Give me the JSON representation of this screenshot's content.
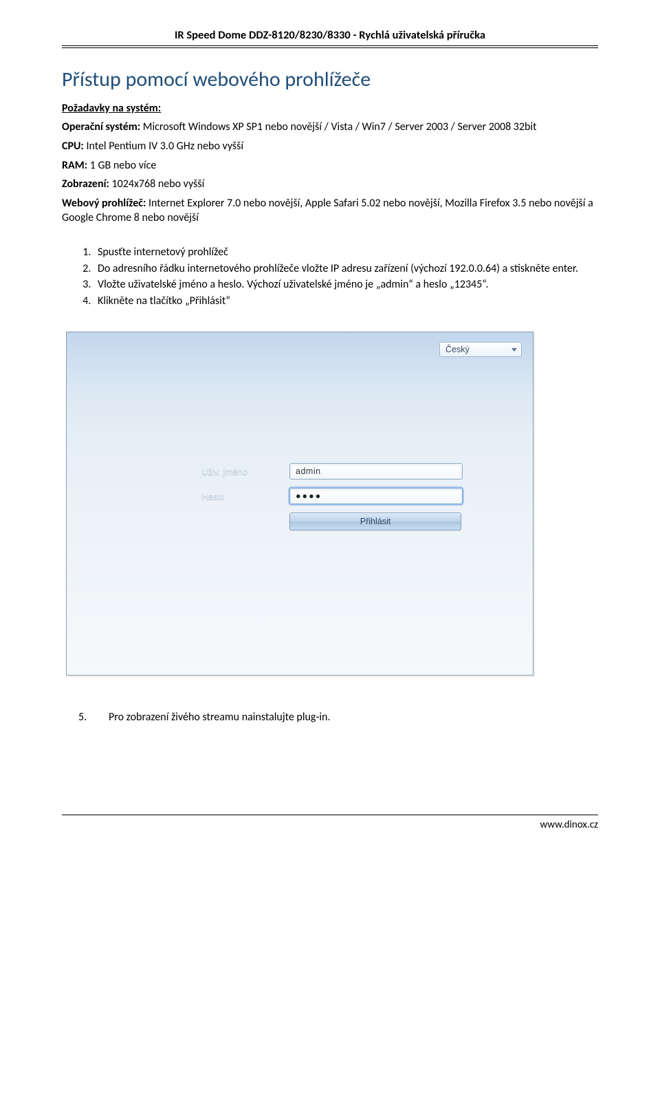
{
  "doc": {
    "header": "IR Speed Dome DDZ-8120/8230/8330 - Rychlá uživatelská příručka",
    "title": "Přístup pomocí webového prohlížeče",
    "subhead": "Požadavky na systém:",
    "specs": {
      "os_label": "Operační systém:",
      "os_value": " Microsoft Windows XP SP1 nebo novější / Vista / Win7 / Server 2003 / Server 2008 32bit",
      "cpu_label": "CPU:",
      "cpu_value": " Intel Pentium IV 3.0 GHz nebo vyšší",
      "ram_label": "RAM:",
      "ram_value": " 1 GB nebo více",
      "disp_label": "Zobrazení:",
      "disp_value": " 1024x768 nebo vyšší",
      "browser_label": "Webový prohlížeč:",
      "browser_value": " Internet Explorer 7.0 nebo novější, Apple Safari 5.02 nebo novější, Mozilla Firefox 3.5 nebo novější a Google Chrome 8 nebo novější"
    },
    "steps": {
      "s1": "Spusťte internetový prohlížeč",
      "s2": "Do adresního řádku internetového prohlížeče vložte IP adresu zařízení (výchozí 192.0.0.64) a stiskněte enter.",
      "s3": "Vložte uživatelské jméno a heslo. Výchozí uživatelské jméno je „admin“ a heslo „12345“.",
      "s4": "Klikněte na tlačítko „Přihlásit“"
    },
    "after_num": "5.",
    "after_text": "Pro zobrazení živého streamu nainstalujte plug-in.",
    "footer": "www.dinox.cz"
  },
  "login": {
    "lang": "Český",
    "user_label": "Uživ. jméno",
    "user_value": "admin",
    "pass_label": "Heslo",
    "pass_dots": "●●●●",
    "button": "Přihlásit"
  }
}
